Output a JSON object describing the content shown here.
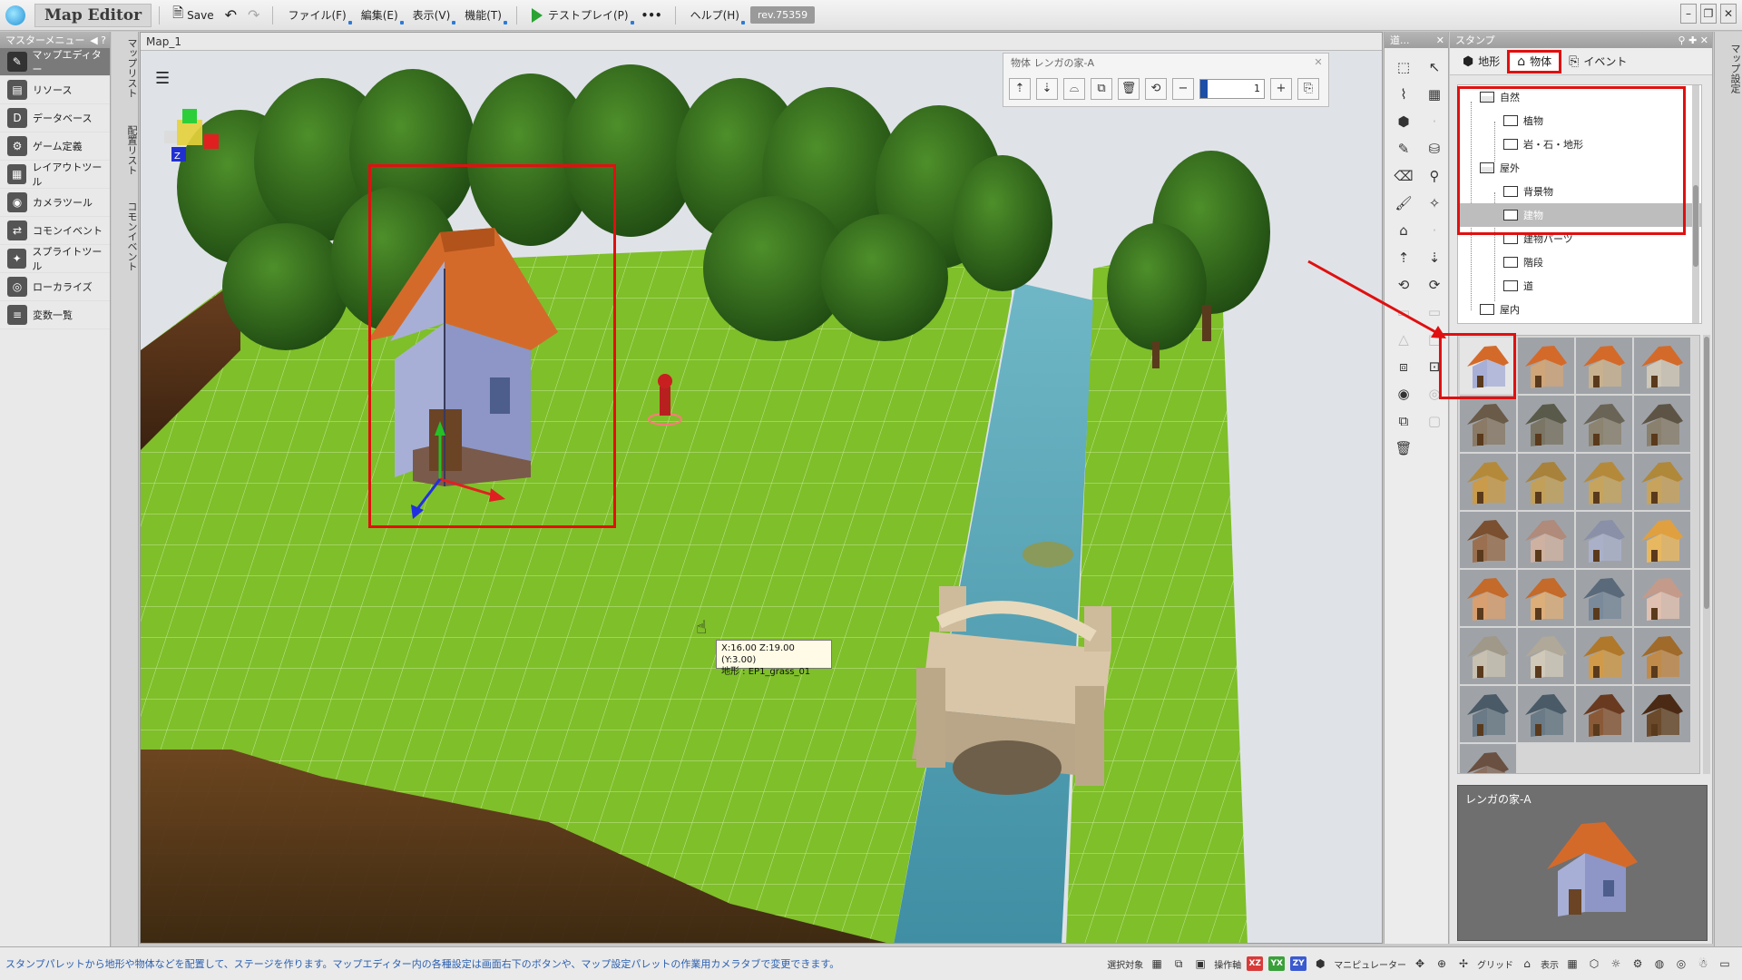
{
  "titlebar": {
    "app_title": "Map Editor",
    "save": "Save",
    "menus": [
      "ファイル(F)",
      "編集(E)",
      "表示(V)",
      "機能(T)"
    ],
    "testplay": "テストプレイ(P)",
    "more": "•••",
    "help": "ヘルプ(H)",
    "revision": "rev.75359"
  },
  "master_menu": {
    "header": "マスターメニュー",
    "items": [
      {
        "label": "マップエディター",
        "icon": "map-edit-icon"
      },
      {
        "label": "リソース",
        "icon": "resource-icon"
      },
      {
        "label": "データベース",
        "icon": "database-icon"
      },
      {
        "label": "ゲーム定義",
        "icon": "game-def-icon"
      },
      {
        "label": "レイアウトツール",
        "icon": "layout-icon"
      },
      {
        "label": "カメラツール",
        "icon": "camera-icon"
      },
      {
        "label": "コモンイベント",
        "icon": "common-event-icon"
      },
      {
        "label": "スプライトツール",
        "icon": "sprite-icon"
      },
      {
        "label": "ローカライズ",
        "icon": "localize-icon"
      },
      {
        "label": "変数一覧",
        "icon": "variables-icon"
      }
    ]
  },
  "side_tabs": [
    "マップリスト",
    "配置リスト",
    "コモンイベント"
  ],
  "right_tabs": [
    "マップ設定"
  ],
  "viewport": {
    "tab": "Map_1",
    "object_toolbar": {
      "title": "物体 レンガの家-A",
      "count": "1"
    },
    "tooltip": {
      "line1": "X:16.00 Z:19.00 (Y:3.00)",
      "line2": "地形 : EP1_grass_01"
    }
  },
  "tools_panel": {
    "header": "道..."
  },
  "stamp_panel": {
    "header": "スタンプ",
    "tabs": [
      {
        "label": "地形",
        "icon": "terrain-icon"
      },
      {
        "label": "物体",
        "icon": "house-icon"
      },
      {
        "label": "イベント",
        "icon": "event-icon"
      }
    ],
    "tree": [
      {
        "label": "自然",
        "depth": 0,
        "open": true
      },
      {
        "label": "植物",
        "depth": 1
      },
      {
        "label": "岩・石・地形",
        "depth": 1
      },
      {
        "label": "屋外",
        "depth": 0,
        "open": true
      },
      {
        "label": "背景物",
        "depth": 1
      },
      {
        "label": "建物",
        "depth": 1,
        "selected": true
      },
      {
        "label": "建物パーツ",
        "depth": 1
      },
      {
        "label": "階段",
        "depth": 1
      },
      {
        "label": "道",
        "depth": 1
      },
      {
        "label": "屋内",
        "depth": 0
      }
    ],
    "preview_title": "レンガの家-A"
  },
  "statusbar": {
    "message": "スタンプパレットから地形や物体などを配置して、ステージを作ります。マップエディター内の各種設定は画面右下のボタンや、マップ設定パレットの作業用カメラタブで変更できます。",
    "select_label": "選択対象",
    "axis_label": "操作軸",
    "axes": [
      "XZ",
      "YX",
      "ZY"
    ],
    "manipulator_label": "マニピュレーター",
    "grid_label": "グリッド",
    "display_label": "表示"
  },
  "colors": {
    "highlight": "#e01010",
    "grass": "#7fbf2a",
    "water": "#4f9fb0",
    "roof": "#d46a2a"
  }
}
